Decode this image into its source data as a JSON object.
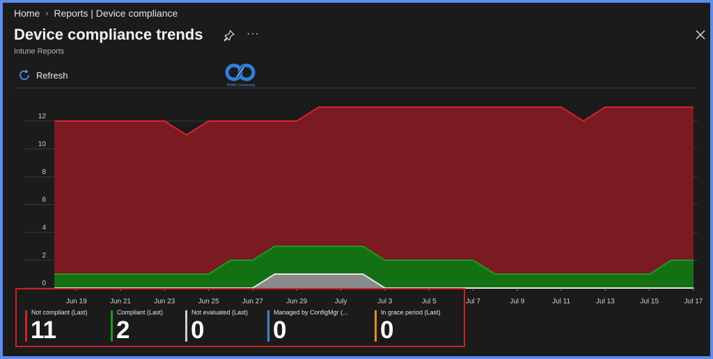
{
  "breadcrumb": {
    "home": "Home",
    "separator": "›",
    "section": "Reports | Device compliance"
  },
  "page": {
    "title": "Device compliance trends",
    "subtitle": "Intune Reports",
    "more": "···"
  },
  "toolbar": {
    "refresh_label": "Refresh"
  },
  "logo": {
    "text": "HTMD Community"
  },
  "colors": {
    "not_compliant": "#7b1a21",
    "compliant": "#137114",
    "not_evaluated": "#8a8a8a",
    "configmgr": "#3f86cc",
    "grace": "#e58f27"
  },
  "chart_data": {
    "type": "area",
    "y_ticks": [
      0,
      2,
      4,
      6,
      8,
      10,
      12
    ],
    "ylim": [
      0,
      13.5
    ],
    "x_labels": [
      "Jun 19",
      "Jun 21",
      "Jun 23",
      "Jun 25",
      "Jun 27",
      "Jun 29",
      "July",
      "Jul 3",
      "Jul 5",
      "Jul 7",
      "Jul 9",
      "Jul 11",
      "Jul 13",
      "Jul 15",
      "Jul 17"
    ],
    "x_label_days": [
      1,
      3,
      5,
      7,
      9,
      11,
      13,
      15,
      17,
      19,
      21,
      23,
      25,
      27,
      29
    ],
    "days": [
      0,
      1,
      2,
      3,
      4,
      5,
      6,
      7,
      8,
      9,
      10,
      11,
      12,
      13,
      14,
      15,
      16,
      17,
      18,
      19,
      20,
      21,
      22,
      23,
      24,
      25,
      26,
      27,
      28,
      29
    ],
    "series": [
      {
        "name": "Not compliant (Last)",
        "key": "not_compliant",
        "totals": [
          12,
          12,
          12,
          12,
          12,
          12,
          11,
          12,
          12,
          12,
          12,
          12,
          13,
          13,
          13,
          13,
          13,
          13,
          13,
          13,
          13,
          13,
          13,
          13,
          12,
          13,
          13,
          13,
          13,
          13
        ]
      },
      {
        "name": "Compliant (Last)",
        "key": "compliant",
        "values": [
          1,
          1,
          1,
          1,
          1,
          1,
          1,
          1,
          2,
          2,
          3,
          3,
          3,
          3,
          3,
          2,
          2,
          2,
          2,
          2,
          1,
          1,
          1,
          1,
          1,
          1,
          1,
          1,
          2,
          2
        ]
      },
      {
        "name": "Not evaluated (Last)",
        "key": "not_evaluated",
        "values": [
          0,
          0,
          0,
          0,
          0,
          0,
          0,
          0,
          0,
          0,
          1,
          1,
          1,
          1,
          1,
          0,
          0,
          0,
          0,
          0,
          0,
          0,
          0,
          0,
          0,
          0,
          0,
          0,
          0,
          0
        ]
      }
    ]
  },
  "legend": [
    {
      "label": "Not compliant (Last)",
      "value": "11",
      "color": "#d6232c"
    },
    {
      "label": "Compliant (Last)",
      "value": "2",
      "color": "#1f9a1f"
    },
    {
      "label": "Not evaluated (Last)",
      "value": "0",
      "color": "#cfcfcf"
    },
    {
      "label": "Managed by ConfigMgr (...",
      "value": "0",
      "color": "#3f86cc"
    },
    {
      "label": "In grace period (Last)",
      "value": "0",
      "color": "#e58f27"
    }
  ]
}
